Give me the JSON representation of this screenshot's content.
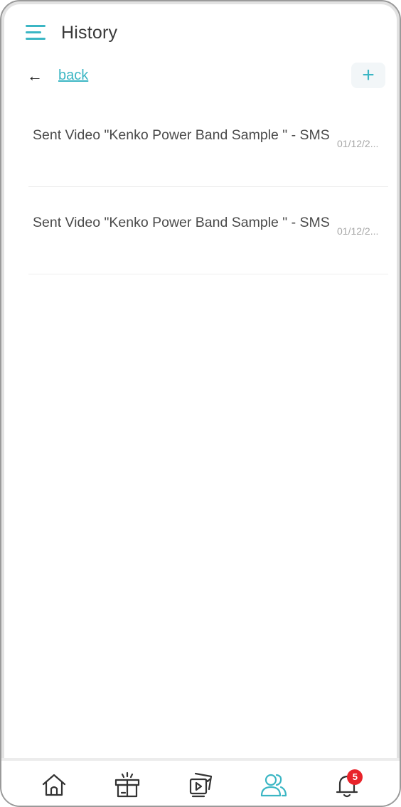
{
  "header": {
    "title": "History",
    "menu_icon": "menu-icon"
  },
  "subbar": {
    "back_arrow": "←",
    "back_label": "back",
    "add_label": "+"
  },
  "history": {
    "items": [
      {
        "text": "Sent Video \"Kenko Power Band Sample \" - SMS",
        "date": "01/12/2..."
      },
      {
        "text": "Sent Video \"Kenko Power Band Sample \" - SMS",
        "date": "01/12/2..."
      }
    ]
  },
  "bottom_nav": {
    "items": [
      {
        "icon": "home-icon"
      },
      {
        "icon": "gift-icon"
      },
      {
        "icon": "media-icon"
      },
      {
        "icon": "contacts-icon",
        "active": true
      },
      {
        "icon": "bell-icon",
        "badge": "5"
      }
    ]
  },
  "colors": {
    "accent": "#3bb6c4",
    "text": "#4a4a4a",
    "muted": "#a8a8a8",
    "badge": "#e8232a"
  }
}
